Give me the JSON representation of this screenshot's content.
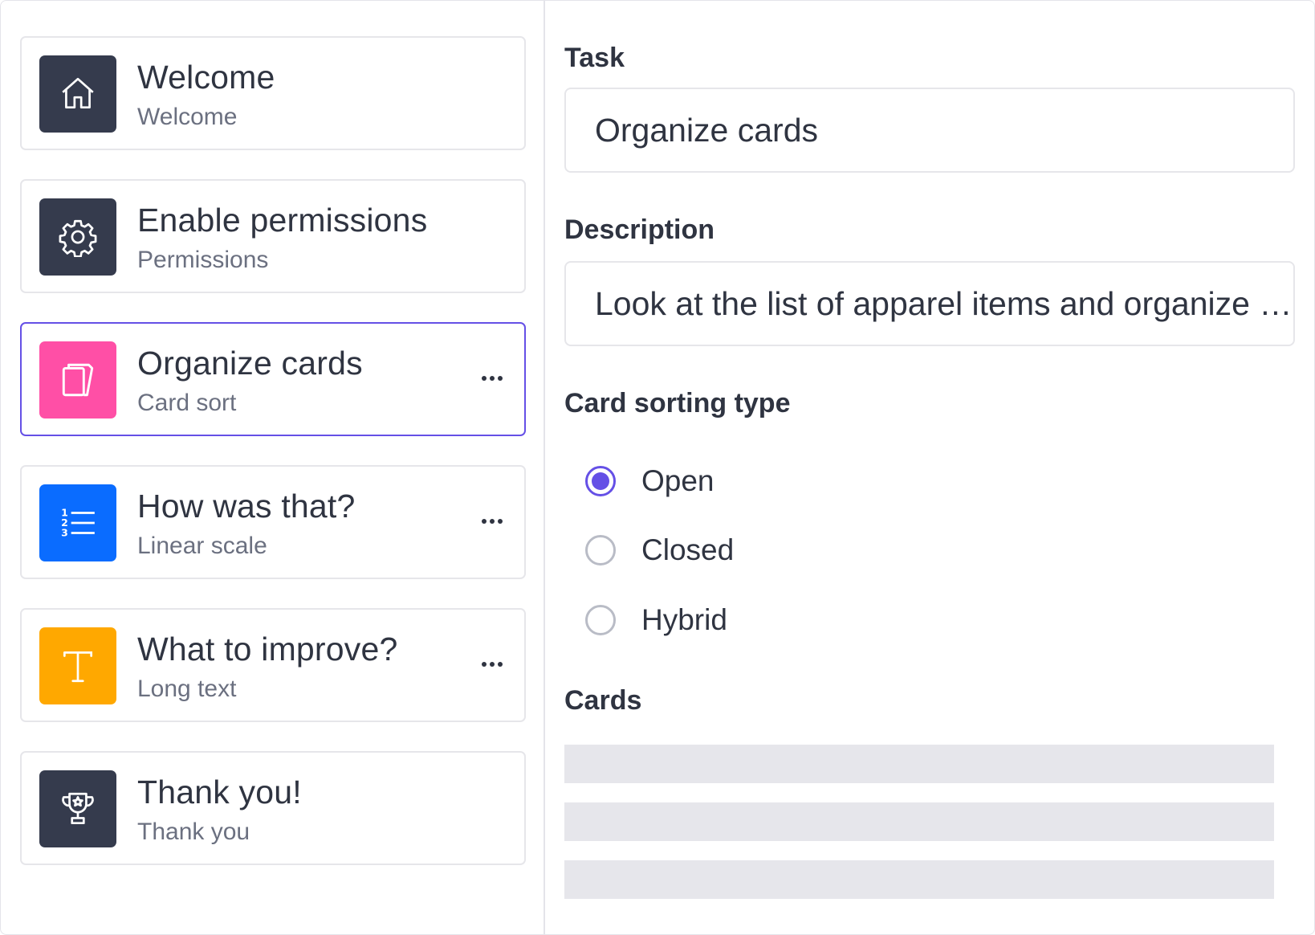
{
  "sidebar": {
    "items": [
      {
        "title": "Welcome",
        "subtitle": "Welcome",
        "icon": "home-icon",
        "color": "#353b4d",
        "has_menu": false,
        "selected": false
      },
      {
        "title": "Enable permissions",
        "subtitle": "Permissions",
        "icon": "gear-icon",
        "color": "#353b4d",
        "has_menu": false,
        "selected": false
      },
      {
        "title": "Organize cards",
        "subtitle": "Card sort",
        "icon": "cards-icon",
        "color": "#ff4fa6",
        "has_menu": true,
        "selected": true
      },
      {
        "title": "How was that?",
        "subtitle": "Linear scale",
        "icon": "numbered-list-icon",
        "color": "#0a6cff",
        "has_menu": true,
        "selected": false
      },
      {
        "title": "What to improve?",
        "subtitle": "Long text",
        "icon": "text-icon",
        "color": "#ffa800",
        "has_menu": true,
        "selected": false
      },
      {
        "title": "Thank you!",
        "subtitle": "Thank you",
        "icon": "trophy-icon",
        "color": "#353b4d",
        "has_menu": false,
        "selected": false
      }
    ]
  },
  "panel": {
    "task_label": "Task",
    "task_value": "Organize cards",
    "description_label": "Description",
    "description_value": "Look at the list of apparel items and organize them",
    "sorting_label": "Card sorting type",
    "sorting_options": [
      {
        "label": "Open",
        "checked": true
      },
      {
        "label": "Closed",
        "checked": false
      },
      {
        "label": "Hybrid",
        "checked": false
      }
    ],
    "cards_label": "Cards"
  },
  "colors": {
    "accent": "#6550e6",
    "text": "#2f3441",
    "muted": "#6b7080",
    "border": "#e6e6ea",
    "placeholder": "#e6e6eb"
  }
}
